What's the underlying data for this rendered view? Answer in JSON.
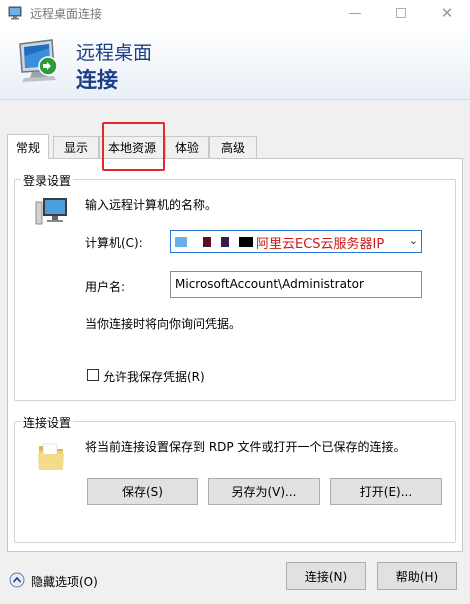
{
  "window": {
    "title": "远程桌面连接",
    "minimize_icon": "minimize-icon",
    "maximize_icon": "maximize-icon",
    "close_icon": "close-icon"
  },
  "header": {
    "line1": "远程桌面",
    "line2": "连接"
  },
  "tabs": [
    {
      "label": "常规"
    },
    {
      "label": "显示"
    },
    {
      "label": "本地资源"
    },
    {
      "label": "体验"
    },
    {
      "label": "高级"
    }
  ],
  "login_group": {
    "title": "登录设置",
    "instruction": "输入远程计算机的名称。",
    "computer_label": "计算机(C):",
    "computer_value": "阿里云ECS云服务器IP",
    "username_label": "用户名:",
    "username_value": "MicrosoftAccount\\Administrator",
    "credential_note": "当你连接时将向你询问凭据。",
    "save_credentials_label": "允许我保存凭据(R)",
    "save_credentials_checked": false
  },
  "connection_group": {
    "title": "连接设置",
    "description": "将当前连接设置保存到 RDP 文件或打开一个已保存的连接。",
    "save_label": "保存(S)",
    "save_as_label": "另存为(V)...",
    "open_label": "打开(E)..."
  },
  "footer": {
    "hide_options_label": "隐藏选项(O)",
    "connect_label": "连接(N)",
    "help_label": "帮助(H)"
  },
  "colors": {
    "header_text": "#1b3f84",
    "highlight_red": "#e4282b",
    "focus_blue": "#2b79d6"
  }
}
